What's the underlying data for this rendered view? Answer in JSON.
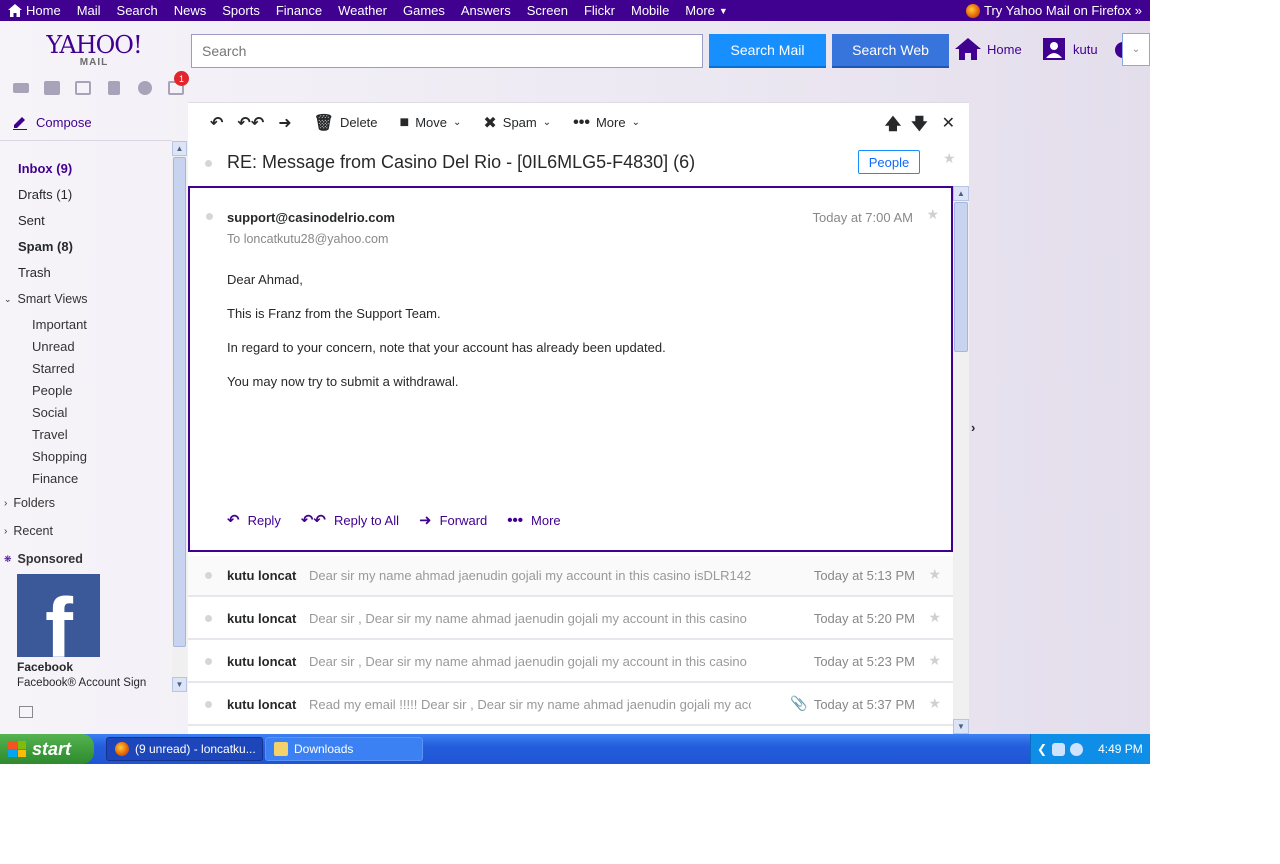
{
  "topnav": {
    "items": [
      "Home",
      "Mail",
      "Search",
      "News",
      "Sports",
      "Finance",
      "Weather",
      "Games",
      "Answers",
      "Screen",
      "Flickr",
      "Mobile",
      "More"
    ],
    "promo": "Try Yahoo Mail on Firefox »"
  },
  "header": {
    "logo_top": "YAHOO!",
    "logo_bottom": "MAIL",
    "search_placeholder": "Search",
    "search_mail": "Search Mail",
    "search_web": "Search Web",
    "home": "Home",
    "user": "kutu",
    "notifications": "1"
  },
  "sidebar": {
    "compose": "Compose",
    "folders": [
      {
        "label": "Inbox (9)"
      },
      {
        "label": "Drafts (1)"
      },
      {
        "label": "Sent"
      },
      {
        "label": "Spam (8)"
      },
      {
        "label": "Trash"
      }
    ],
    "smart_views_label": "Smart Views",
    "smart_views": [
      "Important",
      "Unread",
      "Starred",
      "People",
      "Social",
      "Travel",
      "Shopping",
      "Finance"
    ],
    "folders_label": "Folders",
    "recent_label": "Recent",
    "sponsored_label": "Sponsored",
    "ad_title": "Facebook",
    "ad_sub": "Facebook® Account Sign"
  },
  "toolbar": {
    "delete": "Delete",
    "move": "Move",
    "spam": "Spam",
    "more": "More"
  },
  "conversation": {
    "subject": "RE: Message from Casino Del Rio - [0IL6MLG5-F4830] (6)",
    "people_button": "People"
  },
  "open_message": {
    "sender": "support@casinodelrio.com",
    "to_prefix": "To",
    "to": "loncatkutu28@yahoo.com",
    "time": "Today at 7:00 AM",
    "body": [
      "Dear Ahmad,",
      "This is Franz from the Support Team.",
      "In regard to your concern, note that your account has already been updated.",
      "You may now try to submit a withdrawal."
    ],
    "actions": {
      "reply": "Reply",
      "reply_all": "Reply to All",
      "forward": "Forward",
      "more": "More"
    }
  },
  "thread": [
    {
      "sender": "kutu loncat",
      "snippet": "Dear sir my name ahmad jaenudin gojali my account in this casino isDLR142",
      "time": "Today at 5:13 PM"
    },
    {
      "sender": "kutu loncat",
      "snippet": "Dear sir , Dear sir my name ahmad jaenudin gojali my account in this casino",
      "time": "Today at 5:20 PM"
    },
    {
      "sender": "kutu loncat",
      "snippet": "Dear sir , Dear sir my name ahmad jaenudin gojali my account in this casino",
      "time": "Today at 5:23 PM"
    },
    {
      "sender": "kutu loncat",
      "snippet": "Read my email !!!!! Dear sir , Dear sir my name ahmad jaenudin gojali my account",
      "time": "Today at 5:37 PM"
    }
  ],
  "taskbar": {
    "start": "start",
    "task_firefox": "(9 unread) - loncatku...",
    "task_downloads": "Downloads",
    "clock": "4:49 PM"
  },
  "colors": {
    "brand": "#400090",
    "search_mail": "#188fff",
    "search_web": "#3775dd"
  }
}
